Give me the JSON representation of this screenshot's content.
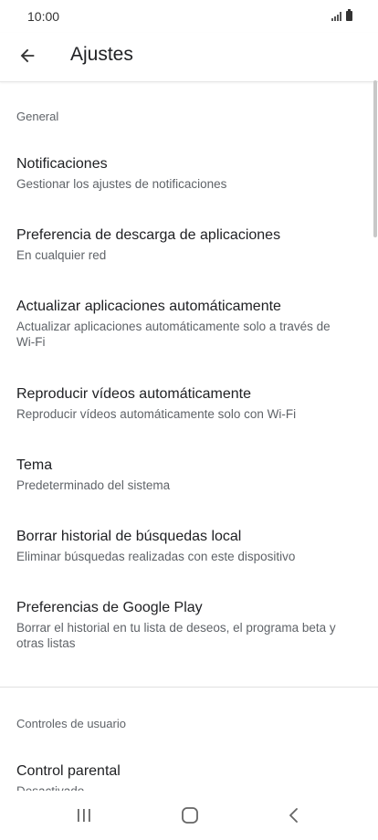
{
  "status_bar": {
    "time": "10:00",
    "signal_icon": "signal-bars-icon",
    "battery_icon": "battery-icon"
  },
  "app_bar": {
    "back_icon": "arrow-back-icon",
    "title": "Ajustes"
  },
  "sections": [
    {
      "header": "General",
      "items": [
        {
          "title": "Notificaciones",
          "subtitle": "Gestionar los ajustes de notificaciones"
        },
        {
          "title": "Preferencia de descarga de aplicaciones",
          "subtitle": "En cualquier red"
        },
        {
          "title": "Actualizar aplicaciones automáticamente",
          "subtitle": "Actualizar aplicaciones automáticamente solo a través de Wi-Fi"
        },
        {
          "title": "Reproducir vídeos automáticamente",
          "subtitle": "Reproducir vídeos automáticamente solo con Wi-Fi"
        },
        {
          "title": "Tema",
          "subtitle": "Predeterminado del sistema"
        },
        {
          "title": "Borrar historial de búsquedas local",
          "subtitle": "Eliminar búsquedas realizadas con este dispositivo"
        },
        {
          "title": "Preferencias de Google Play",
          "subtitle": "Borrar el historial en tu lista de deseos, el programa beta y otras listas"
        }
      ]
    },
    {
      "header": "Controles de usuario",
      "items": [
        {
          "title": "Control parental",
          "subtitle": "Desactivado"
        }
      ]
    }
  ],
  "nav_bar": {
    "recents_icon": "recents-icon",
    "home_icon": "home-icon",
    "back_icon": "nav-back-icon"
  },
  "colors": {
    "primary_text": "#202124",
    "secondary_text": "#5f6368",
    "divider": "#e0e0e0",
    "background": "#ffffff"
  }
}
